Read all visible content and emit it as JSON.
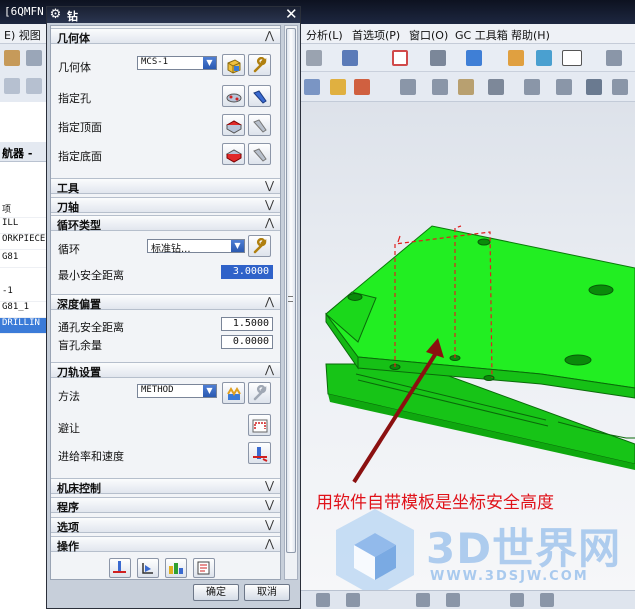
{
  "app": {
    "title": "[6QMFN",
    "menu_left": "E)  视图",
    "menus": [
      "分析(L)",
      "首选项(P)",
      "窗口(O)",
      "GC 工具箱",
      "帮助(H)"
    ]
  },
  "navigator": {
    "header": "航器 -",
    "rows": [
      "项",
      "ILL",
      "ORKPIECE",
      "G81",
      "-1",
      "G81_1",
      "DRILLIN"
    ]
  },
  "dialog": {
    "title": "钻",
    "geometry": {
      "header": "几何体",
      "geometry_label": "几何体",
      "geometry_value": "MCS-1",
      "hole_label": "指定孔",
      "top_label": "指定顶面",
      "bottom_label": "指定底面"
    },
    "tool_header": "工具",
    "axis_header": "刀轴",
    "cycle": {
      "header": "循环类型",
      "cycle_label": "循环",
      "cycle_value": "标准钻...",
      "min_clearance_label": "最小安全距离",
      "min_clearance_value": "3.0000"
    },
    "depth": {
      "header": "深度偏置",
      "through_label": "通孔安全距离",
      "through_value": "1.5000",
      "blind_label": "盲孔余量",
      "blind_value": "0.0000"
    },
    "path": {
      "header": "刀轨设置",
      "method_label": "方法",
      "method_value": "METHOD",
      "avoid_label": "避让",
      "feeds_label": "进给率和速度"
    },
    "machine_header": "机床控制",
    "program_header": "程序",
    "options_header": "选项",
    "actions_header": "操作",
    "ok_label": "确定",
    "cancel_label": "取消"
  },
  "annotation": "用软件自带模板是坐标安全高度",
  "watermark": {
    "name": "3D世界网",
    "url": "WWW.3DSJW.COM"
  },
  "colors": {
    "part_green": "#22ee22",
    "annotation_red": "#e0121a",
    "arrow": "#8b1010"
  }
}
